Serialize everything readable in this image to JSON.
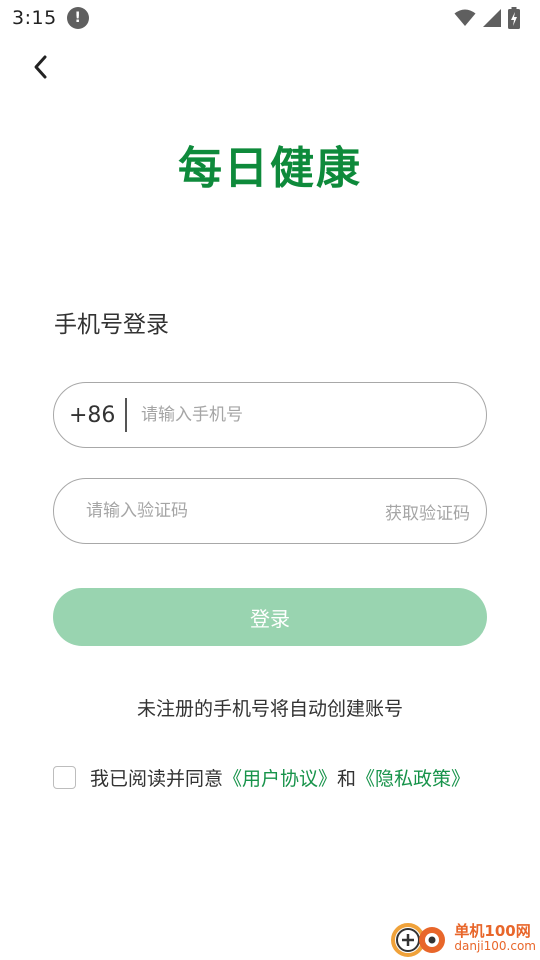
{
  "status_bar": {
    "time": "3:15",
    "icons": [
      "info-icon",
      "wifi-icon",
      "signal-icon",
      "battery-charging-icon"
    ]
  },
  "header": {
    "back_icon": "chevron-left-icon",
    "logo_text": "每日健康"
  },
  "login": {
    "title": "手机号登录",
    "phone": {
      "country_code": "+86",
      "placeholder": "请输入手机号",
      "value": ""
    },
    "code": {
      "placeholder": "请输入验证码",
      "value": "",
      "get_code_label": "获取验证码"
    },
    "submit_label": "登录",
    "notice": "未注册的手机号将自动创建账号",
    "agreement": {
      "checked": false,
      "prefix": "我已阅读并同意",
      "user_agreement": "《用户协议》",
      "conjunction": "和",
      "privacy_policy": "《隐私政策》"
    }
  },
  "watermark": {
    "title": "单机100网",
    "url": "danji100.com"
  },
  "colors": {
    "brand_green": "#0e8a3b",
    "link_green": "#17934a",
    "button_disabled": "#99d4b0",
    "watermark_orange": "#e8662a"
  }
}
